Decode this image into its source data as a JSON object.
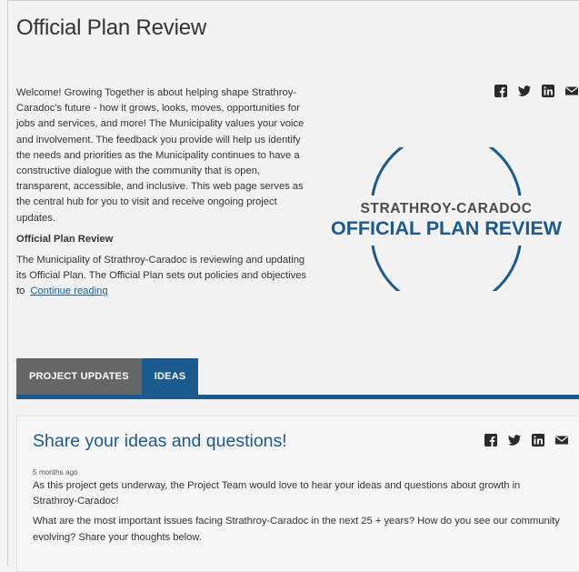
{
  "page": {
    "title": "Official Plan Review"
  },
  "share_icons": [
    "facebook-icon",
    "twitter-icon",
    "linkedin-icon",
    "email-icon"
  ],
  "intro": {
    "paragraph": "Welcome! Growing Together is about helping shape Strathroy-Caradoc's future - how it grows, looks, moves, opportunities for jobs and services, and more! The Municipality values your voice and involvement. The feedback you provide will help us identify the needs and priorities as the Municipality continues to have a constructive dialogue with the community that is open, transparent, accessible, and inclusive. This web page serves as the central hub for you to visit and receive ongoing project updates.",
    "sub_heading": "Official Plan Review",
    "teaser": "The Municipality of Strathroy-Caradoc is reviewing and updating its Official Plan. The Official Plan sets out policies and objectives to",
    "continue_link": "Continue reading"
  },
  "logo": {
    "line1": "STRATHROY-CARADOC",
    "line2": "OFFICIAL PLAN REVIEW",
    "color_primary": "#1b5a8e",
    "color_secondary": "#4a4a4a"
  },
  "tabs": [
    {
      "label": "PROJECT UPDATES",
      "active": false
    },
    {
      "label": "IDEAS",
      "active": true
    }
  ],
  "colors": {
    "accent": "#1b5a8e",
    "inactive_tab": "#666666"
  },
  "post": {
    "title": "Share your ideas and questions!",
    "timestamp": "5 months ago",
    "paragraph1": "As this project gets underway, the Project Team would love to hear your ideas and questions about growth in Strathroy-Caradoc!",
    "paragraph2": "What are the most important issues facing Strathroy-Caradoc in the next 25 + years? How do you see our community evolving? Share your thoughts below."
  }
}
